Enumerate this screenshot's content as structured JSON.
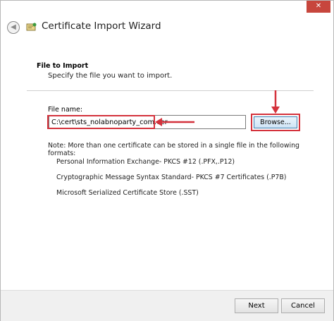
{
  "window": {
    "close_glyph": "✕",
    "title": "Certificate Import Wizard",
    "back_glyph": "◀"
  },
  "section": {
    "title": "File to Import",
    "subtitle": "Specify the file you want to import."
  },
  "file": {
    "label": "File name:",
    "value": "C:\\cert\\sts_nolabnoparty_com.cer"
  },
  "browse": {
    "label": "Browse..."
  },
  "note": "Note:  More than one certificate can be stored in a single file in the following formats:",
  "formats": [
    "Personal Information Exchange- PKCS #12 (.PFX,.P12)",
    "Cryptographic Message Syntax Standard- PKCS #7 Certificates (.P7B)",
    "Microsoft Serialized Certificate Store (.SST)"
  ],
  "footer": {
    "next_label": "Next",
    "cancel_label": "Cancel"
  },
  "colors": {
    "highlight": "#d4323c",
    "close_button": "#c7463d",
    "browse_border": "#3c7fb1"
  }
}
